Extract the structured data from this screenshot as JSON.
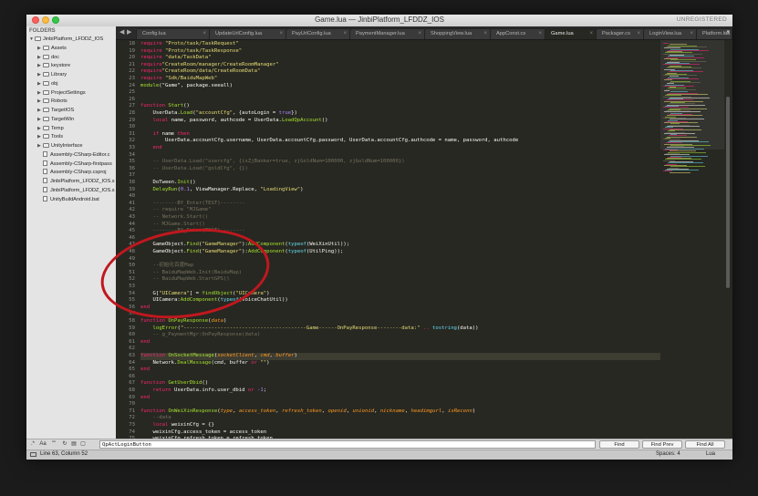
{
  "window": {
    "title": "Game.lua — JinbiPlatform_LFDDZ_IOS",
    "unregistered": "UNREGISTERED"
  },
  "sidebar": {
    "header": "FOLDERS",
    "items": [
      {
        "label": "JinbiPlatform_LFDDZ_IOS",
        "type": "folder",
        "open": true,
        "depth": 0
      },
      {
        "label": "Assets",
        "type": "folder",
        "open": false,
        "depth": 1
      },
      {
        "label": "doc",
        "type": "folder",
        "open": false,
        "depth": 1
      },
      {
        "label": "keystore",
        "type": "folder",
        "open": false,
        "depth": 1
      },
      {
        "label": "Library",
        "type": "folder",
        "open": false,
        "depth": 1
      },
      {
        "label": "obj",
        "type": "folder",
        "open": false,
        "depth": 1
      },
      {
        "label": "ProjectSettings",
        "type": "folder",
        "open": false,
        "depth": 1
      },
      {
        "label": "Robots",
        "type": "folder",
        "open": false,
        "depth": 1
      },
      {
        "label": "TargetIOS",
        "type": "folder",
        "open": false,
        "depth": 1
      },
      {
        "label": "TargetWin",
        "type": "folder",
        "open": false,
        "depth": 1
      },
      {
        "label": "Temp",
        "type": "folder",
        "open": false,
        "depth": 1
      },
      {
        "label": "Tools",
        "type": "folder",
        "open": false,
        "depth": 1
      },
      {
        "label": "UnityInterface",
        "type": "folder",
        "open": false,
        "depth": 1
      },
      {
        "label": "Assembly-CSharp-Editor.c",
        "type": "file",
        "depth": 1
      },
      {
        "label": "Assembly-CSharp-firstpass",
        "type": "file",
        "depth": 1
      },
      {
        "label": "Assembly-CSharp.csproj",
        "type": "file",
        "depth": 1
      },
      {
        "label": "JinbiPlatform_LFDDZ_IOS.s",
        "type": "file",
        "depth": 1
      },
      {
        "label": "JinbiPlatform_LFDDZ_IOS.s",
        "type": "file",
        "depth": 1
      },
      {
        "label": "UnityBuildAndroid.bat",
        "type": "file",
        "depth": 1
      }
    ]
  },
  "tabs": [
    {
      "label": "Config.lua",
      "active": false
    },
    {
      "label": "UpdateUrlConfig.lua",
      "active": false
    },
    {
      "label": "PayUrlConfig.lua",
      "active": false
    },
    {
      "label": "PaymentManager.lua",
      "active": false
    },
    {
      "label": "ShoppingView.lua",
      "active": false
    },
    {
      "label": "AppConst.cs",
      "active": false
    },
    {
      "label": "Game.lua",
      "active": true
    },
    {
      "label": "Packager.cs",
      "active": false
    },
    {
      "label": "LoginView.lua",
      "active": false
    },
    {
      "label": "Platform.lua",
      "active": false
    }
  ],
  "editor": {
    "current_line": 63,
    "lines": [
      {
        "n": 18,
        "t": [
          [
            "k",
            "require "
          ],
          [
            "s",
            "\"Proto/task/TaskRequest\""
          ]
        ]
      },
      {
        "n": 19,
        "t": [
          [
            "k",
            "require "
          ],
          [
            "s",
            "\"Proto/task/TaskResponse\""
          ]
        ]
      },
      {
        "n": 20,
        "t": [
          [
            "k",
            "require "
          ],
          [
            "s",
            "\"data/TaskData\""
          ]
        ]
      },
      {
        "n": 21,
        "t": [
          [
            "k",
            "require"
          ],
          [
            "s",
            "\"CreateRoom/manager/CreateRoomManager\""
          ]
        ]
      },
      {
        "n": 22,
        "t": [
          [
            "k",
            "require"
          ],
          [
            "s",
            "\"CreateRoom/data/CreateRoomData\""
          ]
        ]
      },
      {
        "n": 23,
        "t": [
          [
            "k",
            "require "
          ],
          [
            "s",
            "\"Sdk/BaiduMapWeb\""
          ]
        ]
      },
      {
        "n": 24,
        "t": [
          [
            "f",
            "module"
          ],
          [
            "",
            "(\"Game\", package.seeall)"
          ]
        ]
      },
      {
        "n": 25,
        "t": []
      },
      {
        "n": 26,
        "t": []
      },
      {
        "n": 27,
        "t": [
          [
            "k",
            "function "
          ],
          [
            "f",
            "Start"
          ],
          [
            "",
            "()"
          ]
        ]
      },
      {
        "n": 28,
        "t": [
          [
            "",
            "    UserData."
          ],
          [
            "f",
            "Load"
          ],
          [
            "",
            "("
          ],
          [
            "s",
            "\"accountCfg\""
          ],
          [
            "",
            ", {autoLogin = "
          ],
          [
            "n",
            "true"
          ],
          [
            "",
            "})"
          ]
        ]
      },
      {
        "n": 29,
        "t": [
          [
            "k",
            "    local "
          ],
          [
            "",
            "name, password, authcode = UserData."
          ],
          [
            "f",
            "LoadQpAccount"
          ],
          [
            "",
            "()"
          ]
        ]
      },
      {
        "n": 30,
        "t": []
      },
      {
        "n": 31,
        "t": [
          [
            "k",
            "    if "
          ],
          [
            "",
            "name "
          ],
          [
            "k",
            "then"
          ]
        ]
      },
      {
        "n": 32,
        "t": [
          [
            "",
            "        UserData.accountCfg.username, UserData.accountCfg.password, UserData.accountCfg.authcode = name, password, authcode"
          ]
        ]
      },
      {
        "n": 33,
        "t": [
          [
            "k",
            "    end"
          ]
        ]
      },
      {
        "n": 34,
        "t": []
      },
      {
        "n": 35,
        "t": [
          [
            "c",
            "    -- UserData.Load(\"usercfg\", {isZjBanker=true, zjGoldNum=100000, zjGoldNum=100000})"
          ]
        ]
      },
      {
        "n": 36,
        "t": [
          [
            "c",
            "    -- UserData.Load(\"goldCfg\", {})"
          ]
        ]
      },
      {
        "n": 37,
        "t": []
      },
      {
        "n": 38,
        "t": [
          [
            "",
            "    DoTween."
          ],
          [
            "f",
            "Init"
          ],
          [
            "",
            "()"
          ]
        ]
      },
      {
        "n": 39,
        "t": [
          [
            "",
            "    "
          ],
          [
            "f",
            "DelayRun"
          ],
          [
            "",
            "("
          ],
          [
            "n",
            "0.1"
          ],
          [
            "",
            ", ViewManager.Replace, "
          ],
          [
            "s",
            "\"LoadingView\""
          ],
          [
            "",
            ")"
          ]
        ]
      },
      {
        "n": 40,
        "t": []
      },
      {
        "n": 41,
        "t": [
          [
            "c",
            "    --------BY_Enter(TEST)--------"
          ]
        ]
      },
      {
        "n": 42,
        "t": [
          [
            "c",
            "    -- require \"MJGame\""
          ]
        ]
      },
      {
        "n": 43,
        "t": [
          [
            "c",
            "    -- Network.Start()"
          ]
        ]
      },
      {
        "n": 44,
        "t": [
          [
            "c",
            "    -- MJGame.Start()"
          ]
        ]
      },
      {
        "n": 45,
        "t": [
          [
            "c",
            "    --------BY_Enter(TEST)--------"
          ]
        ]
      },
      {
        "n": 46,
        "t": []
      },
      {
        "n": 47,
        "t": [
          [
            "",
            "    GameObject."
          ],
          [
            "f",
            "Find"
          ],
          [
            "",
            "("
          ],
          [
            "s",
            "\"GameManager\""
          ],
          [
            "",
            "):"
          ],
          [
            "f",
            "AddComponent"
          ],
          [
            "",
            "("
          ],
          [
            "b",
            "typeof"
          ],
          [
            "",
            "(WeiXinUtil));"
          ]
        ]
      },
      {
        "n": 48,
        "t": [
          [
            "",
            "    GameObject."
          ],
          [
            "f",
            "Find"
          ],
          [
            "",
            "("
          ],
          [
            "s",
            "\"GameManager\""
          ],
          [
            "",
            "):"
          ],
          [
            "f",
            "AddComponent"
          ],
          [
            "",
            "("
          ],
          [
            "b",
            "typeof"
          ],
          [
            "",
            "(UtilPing));"
          ]
        ]
      },
      {
        "n": 49,
        "t": []
      },
      {
        "n": 50,
        "t": [
          [
            "c",
            "    --初始化百度Map"
          ]
        ]
      },
      {
        "n": 51,
        "t": [
          [
            "c",
            "    -- BaiduMapWeb.Init(BaiduMap)"
          ]
        ]
      },
      {
        "n": 52,
        "t": [
          [
            "c",
            "    -- BaiduMapWeb.StartGPS()"
          ]
        ]
      },
      {
        "n": 53,
        "t": []
      },
      {
        "n": 54,
        "t": [
          [
            "",
            "    G["
          ],
          [
            "s",
            "\"UICamera\""
          ],
          [
            "",
            "] = "
          ],
          [
            "f",
            "findObject"
          ],
          [
            "",
            "("
          ],
          [
            "s",
            "\"UICamera\""
          ],
          [
            "",
            ")"
          ]
        ]
      },
      {
        "n": 55,
        "t": [
          [
            "",
            "    UICamera:"
          ],
          [
            "f",
            "AddComponent"
          ],
          [
            "",
            "("
          ],
          [
            "b",
            "typeof"
          ],
          [
            "",
            "(VoiceChatUtil))"
          ]
        ]
      },
      {
        "n": 56,
        "t": [
          [
            "k",
            "end"
          ]
        ]
      },
      {
        "n": 57,
        "t": []
      },
      {
        "n": 58,
        "t": [
          [
            "k",
            "function "
          ],
          [
            "f",
            "OnPayResponse"
          ],
          [
            "",
            "("
          ],
          [
            "p",
            "data"
          ],
          [
            "",
            ")"
          ]
        ]
      },
      {
        "n": 59,
        "t": [
          [
            "",
            "    "
          ],
          [
            "f",
            "logError"
          ],
          [
            "",
            "("
          ],
          [
            "s",
            "\"----------------------------------------Game------OnPayResponse--------data:\""
          ],
          [
            "k",
            " .. "
          ],
          [
            "b",
            "tostring"
          ],
          [
            "",
            "(data))"
          ]
        ]
      },
      {
        "n": 60,
        "t": [
          [
            "c",
            "    -- g_PaymentMgr:OnPayResponse(data)"
          ]
        ]
      },
      {
        "n": 61,
        "t": [
          [
            "k",
            "end"
          ]
        ]
      },
      {
        "n": 62,
        "t": []
      },
      {
        "n": 63,
        "t": [
          [
            "k",
            "function "
          ],
          [
            "f",
            "OnSocketMessage"
          ],
          [
            "",
            "("
          ],
          [
            "p",
            "socketClient"
          ],
          [
            "",
            ", "
          ],
          [
            "p",
            "cmd"
          ],
          [
            "",
            ", "
          ],
          [
            "p",
            "buffer"
          ],
          [
            "",
            ")"
          ]
        ]
      },
      {
        "n": 64,
        "t": [
          [
            "",
            "    Network."
          ],
          [
            "f",
            "DealMessage"
          ],
          [
            "",
            "(cmd, buffer "
          ],
          [
            "k",
            "or "
          ],
          [
            "s",
            "\"\""
          ],
          [
            "",
            ")"
          ]
        ]
      },
      {
        "n": 65,
        "t": [
          [
            "k",
            "end"
          ]
        ]
      },
      {
        "n": 66,
        "t": []
      },
      {
        "n": 67,
        "t": [
          [
            "k",
            "function "
          ],
          [
            "f",
            "GetUserDbid"
          ],
          [
            "",
            "()"
          ]
        ]
      },
      {
        "n": 68,
        "t": [
          [
            "k",
            "    return "
          ],
          [
            "",
            "UserData.info.user_dbid "
          ],
          [
            "k",
            "or "
          ],
          [
            "n",
            "-1"
          ],
          [
            "",
            ";"
          ]
        ]
      },
      {
        "n": 69,
        "t": [
          [
            "k",
            "end"
          ]
        ]
      },
      {
        "n": 70,
        "t": []
      },
      {
        "n": 71,
        "t": [
          [
            "k",
            "function "
          ],
          [
            "f",
            "OnWeiXinResponse"
          ],
          [
            "",
            "("
          ],
          [
            "p",
            "type"
          ],
          [
            "",
            ", "
          ],
          [
            "p",
            "access_token"
          ],
          [
            "",
            ", "
          ],
          [
            "p",
            "refresh_token"
          ],
          [
            "",
            ", "
          ],
          [
            "p",
            "openid"
          ],
          [
            "",
            ", "
          ],
          [
            "p",
            "unionid"
          ],
          [
            "",
            ", "
          ],
          [
            "p",
            "nickname"
          ],
          [
            "",
            ", "
          ],
          [
            "p",
            "headimgurl"
          ],
          [
            "",
            ", "
          ],
          [
            "p",
            "isReconn"
          ],
          [
            "",
            ")"
          ]
        ]
      },
      {
        "n": 72,
        "t": [
          [
            "c",
            "    --data"
          ]
        ]
      },
      {
        "n": 73,
        "t": [
          [
            "k",
            "    local "
          ],
          [
            "",
            "weixinCfg = {}"
          ]
        ]
      },
      {
        "n": 74,
        "t": [
          [
            "",
            "    weixinCfg.access_token = access_token"
          ]
        ]
      },
      {
        "n": 75,
        "t": [
          [
            "",
            "    weixinCfg.refresh_token = refresh_token"
          ]
        ]
      }
    ]
  },
  "findbar": {
    "case_label": "Aa",
    "word_label": "\"\"",
    "input_value": "QpActLoginButton",
    "find_label": "Find",
    "find_prev_label": "Find Prev",
    "find_all_label": "Find All"
  },
  "status": {
    "position": "Line 63, Column 52",
    "spaces": "Spaces: 4",
    "syntax": "Lua"
  },
  "colors": {
    "editor_bg": "#272822",
    "annotation": "#c0181e"
  }
}
